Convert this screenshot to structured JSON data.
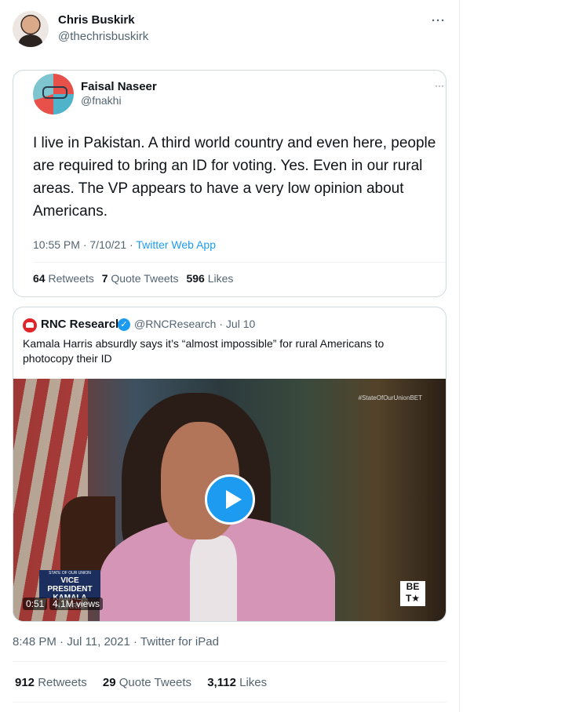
{
  "tweet": {
    "author_name": "Chris Buskirk",
    "author_handle": "@thechrisbuskirk",
    "more_label": "···",
    "time": "8:48 PM",
    "date": "Jul 11, 2021",
    "source": "Twitter for iPad",
    "retweets": "912",
    "retweets_label": "Retweets",
    "quote_tweets": "29",
    "quote_tweets_label": "Quote Tweets",
    "likes": "3,112",
    "likes_label": "Likes"
  },
  "quoted": {
    "author_name": "Faisal Naseer",
    "author_handle": "@fnakhi",
    "more_label": "···",
    "text": "I live in Pakistan. A third world country and even here, people are required to bring an ID for voting. Yes. Even in our rural areas. The VP appears to have a very low opinion about Americans.",
    "time": "10:55 PM",
    "date": "7/10/21",
    "source": "Twitter Web App",
    "retweets": "64",
    "retweets_label": "Retweets",
    "quote_tweets": "7",
    "quote_tweets_label": "Quote Tweets",
    "likes": "596",
    "likes_label": "Likes"
  },
  "embedded": {
    "author_name": "RNC Research",
    "author_handle": "@RNCResearch",
    "date": "Jul 10",
    "text": "Kamala Harris absurdly says it’s “almost impossible” for rural Americans to photocopy their ID",
    "video": {
      "hashtag": "#StateOfOurUnionBET",
      "lower_third_top": "STATE OF OUR UNION",
      "lower_third_line1": "VICE PRESIDENT",
      "lower_third_line2": "KAMALA HARRIS",
      "logo_line1": "BE",
      "logo_line2": "T★",
      "duration": "0:51",
      "views": "4.1M views"
    }
  },
  "colors": {
    "link_blue": "#1d9bf0",
    "secondary_text": "#536471",
    "border": "#cfd9de"
  },
  "icons": {
    "verified": "verified-badge-icon",
    "play": "play-icon",
    "more": "more-icon"
  }
}
